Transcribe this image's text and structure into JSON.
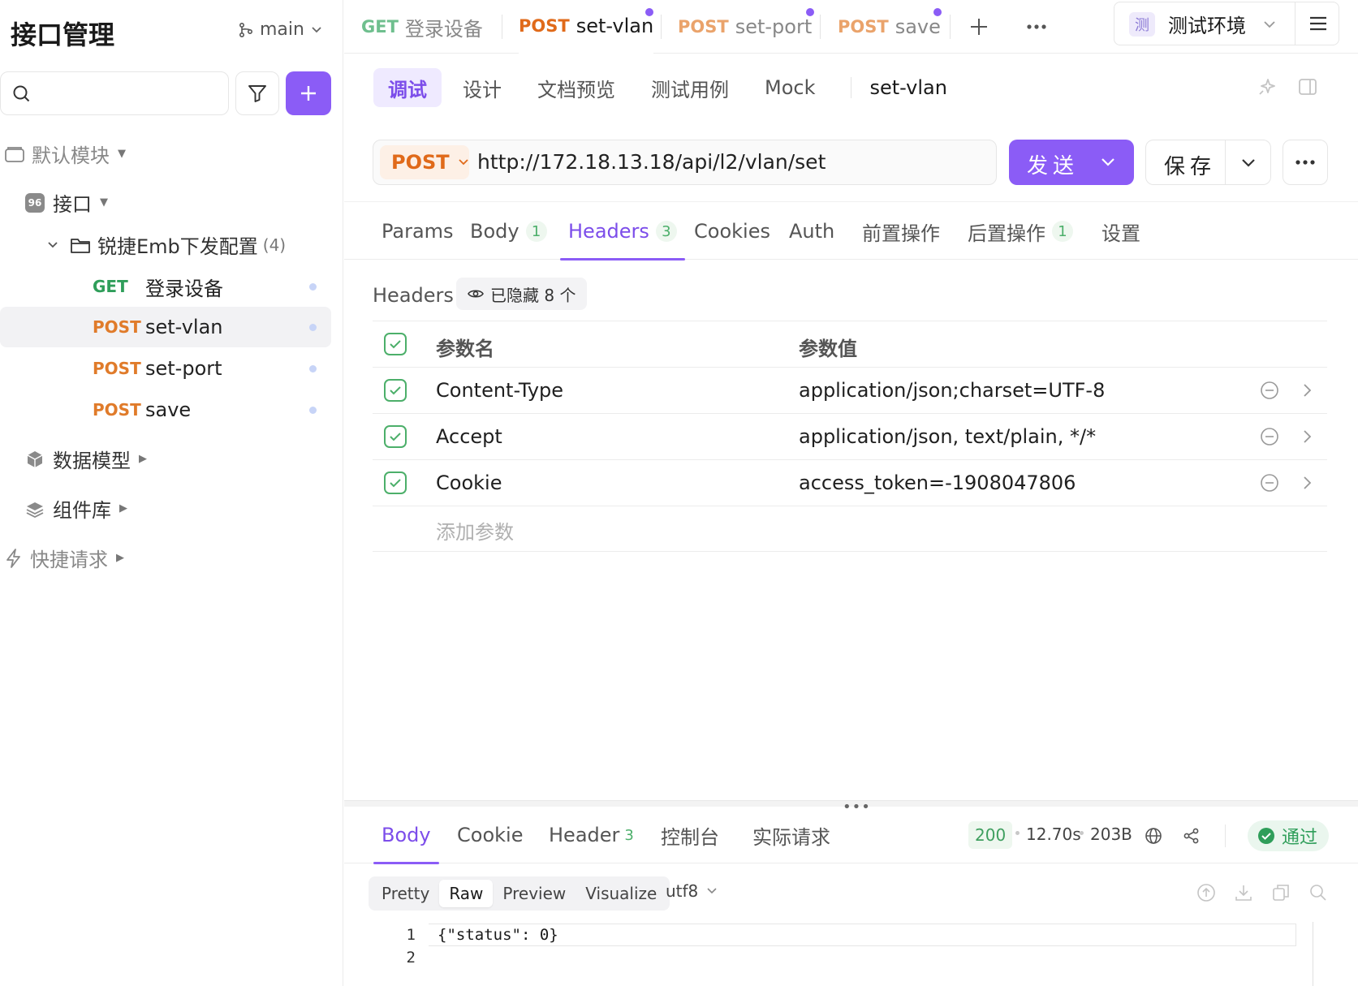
{
  "sidebar": {
    "title": "接口管理",
    "branch": "main",
    "search_placeholder": "",
    "default_module": "默认模块",
    "api_label": "接口",
    "folder": {
      "name": "锐捷Emb下发配置",
      "count": "(4)"
    },
    "endpoints": [
      {
        "method": "GET",
        "name": "登录设备"
      },
      {
        "method": "POST",
        "name": "set-vlan"
      },
      {
        "method": "POST",
        "name": "set-port"
      },
      {
        "method": "POST",
        "name": "save"
      }
    ],
    "data_model": "数据模型",
    "components": "组件库",
    "quick_request": "快捷请求"
  },
  "tabs": [
    {
      "method": "GET",
      "name": "登录设备"
    },
    {
      "method": "POST",
      "name": "set-vlan"
    },
    {
      "method": "POST",
      "name": "set-port"
    },
    {
      "method": "POST",
      "name": "save"
    }
  ],
  "environment": {
    "badge": "测",
    "name": "测试环境"
  },
  "mode_tabs": [
    "调试",
    "设计",
    "文档预览",
    "测试用例",
    "Mock"
  ],
  "mode_title": "set-vlan",
  "request": {
    "method": "POST",
    "url": "http://172.18.13.18/api/l2/vlan/set",
    "send_label": "发送",
    "save_label": "保存"
  },
  "request_tabs": [
    {
      "label": "Params",
      "count": ""
    },
    {
      "label": "Body",
      "count": "1"
    },
    {
      "label": "Headers",
      "count": "3"
    },
    {
      "label": "Cookies",
      "count": ""
    },
    {
      "label": "Auth",
      "count": ""
    },
    {
      "label": "前置操作",
      "count": ""
    },
    {
      "label": "后置操作",
      "count": "1"
    },
    {
      "label": "设置",
      "count": ""
    }
  ],
  "headers_section": {
    "label": "Headers",
    "hidden_text": "已隐藏 8 个",
    "col_name": "参数名",
    "col_value": "参数值",
    "rows": [
      {
        "name": "Content-Type",
        "value": "application/json;charset=UTF-8"
      },
      {
        "name": "Accept",
        "value": " application/json, text/plain, */*"
      },
      {
        "name": "Cookie",
        "value": "access_token=-1908047806"
      }
    ],
    "add_placeholder": "添加参数"
  },
  "response": {
    "tabs": [
      {
        "label": "Body",
        "count": ""
      },
      {
        "label": "Cookie",
        "count": ""
      },
      {
        "label": "Header",
        "count": "3"
      },
      {
        "label": "控制台",
        "count": ""
      },
      {
        "label": "实际请求",
        "count": ""
      }
    ],
    "status": "200",
    "time": "12.70s",
    "size": "203B",
    "result": "通过",
    "formats": [
      "Pretty",
      "Raw",
      "Preview",
      "Visualize"
    ],
    "encoding": "utf8",
    "code_lines": [
      {
        "num": "1",
        "text": "{\"status\": 0}"
      },
      {
        "num": "2",
        "text": ""
      }
    ]
  },
  "colors": {
    "accent": "#8b5cf6",
    "get": "#2f9e5a",
    "post": "#e07b2a",
    "success": "#4caf6a"
  }
}
